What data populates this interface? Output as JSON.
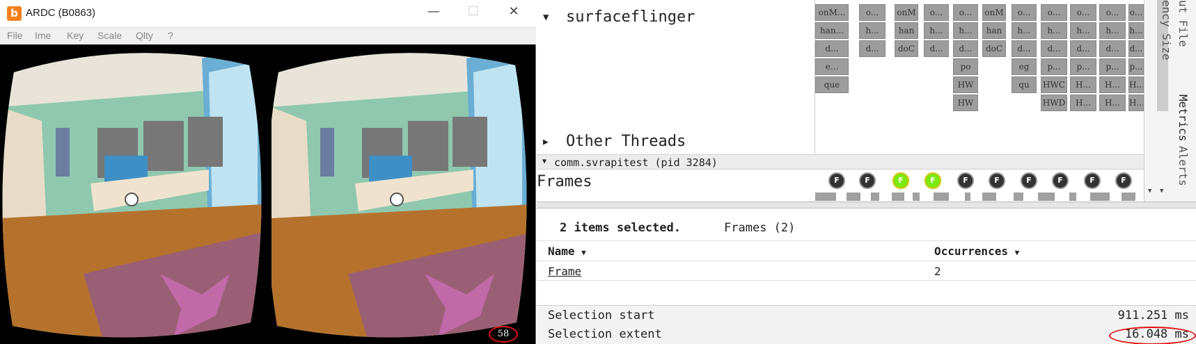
{
  "ardc": {
    "title": "ARDC (B0863)",
    "logo_glyph": "b",
    "menu": [
      "File",
      "Ime",
      "Key",
      "Scale",
      "Qlty",
      "?"
    ],
    "fps": "58",
    "controls": {
      "minimize": "—",
      "maximize": "☐",
      "close": "✕"
    }
  },
  "trace": {
    "threads": {
      "surfaceflinger": "surfaceflinger",
      "other_threads": "Other Threads",
      "expand_glyph": "▼",
      "collapse_glyph": "▶"
    },
    "slice_labels": [
      [
        "onM...",
        "o...",
        "onM",
        "o...",
        "o...",
        "onM",
        "o...",
        "o...",
        "o...",
        "o...",
        "o..."
      ],
      [
        "han...",
        "h...",
        "han",
        "h...",
        "h...",
        "han",
        "h...",
        "h...",
        "h...",
        "h...",
        "h..."
      ],
      [
        "d...",
        "d...",
        "doC",
        "d...",
        "d...",
        "doC",
        "d...",
        "d...",
        "d...",
        "d...",
        "d..."
      ],
      [
        "e...",
        "",
        "",
        "",
        "po",
        "",
        "eg",
        "p...",
        "p...",
        "p...",
        "p..."
      ],
      [
        "que",
        "",
        "",
        "",
        "HW",
        "",
        "qu",
        "HWC",
        "H...",
        "H...",
        "H..."
      ],
      [
        "",
        "",
        "",
        "",
        "HW",
        "",
        "",
        "HWD",
        "H...",
        "H...",
        "H..."
      ]
    ],
    "process": "comm.svrapitest (pid 3284)",
    "frames_label": "Frames",
    "frame_marker": "F",
    "frame_states": [
      false,
      false,
      true,
      true,
      false,
      false,
      false,
      false,
      false,
      false
    ],
    "side_tabs": [
      "ut File",
      "ency Size",
      "Metrics",
      "Alerts"
    ],
    "selection": {
      "summary": "2 items selected.",
      "type": "Frames (2)",
      "columns": [
        "Name",
        "Occurrences"
      ],
      "sort_glyph": "▼",
      "rows": [
        {
          "name": "Frame",
          "occurrences": "2"
        }
      ],
      "start_label": "Selection start",
      "start_value": "911.251 ms",
      "extent_label": "Selection extent",
      "extent_value": "16.048 ms"
    }
  },
  "colors": {
    "slice": "#9d9d9d",
    "selected_frame": "#7bea0c",
    "frame": "#333333",
    "annotation_circle": "#e01010"
  }
}
